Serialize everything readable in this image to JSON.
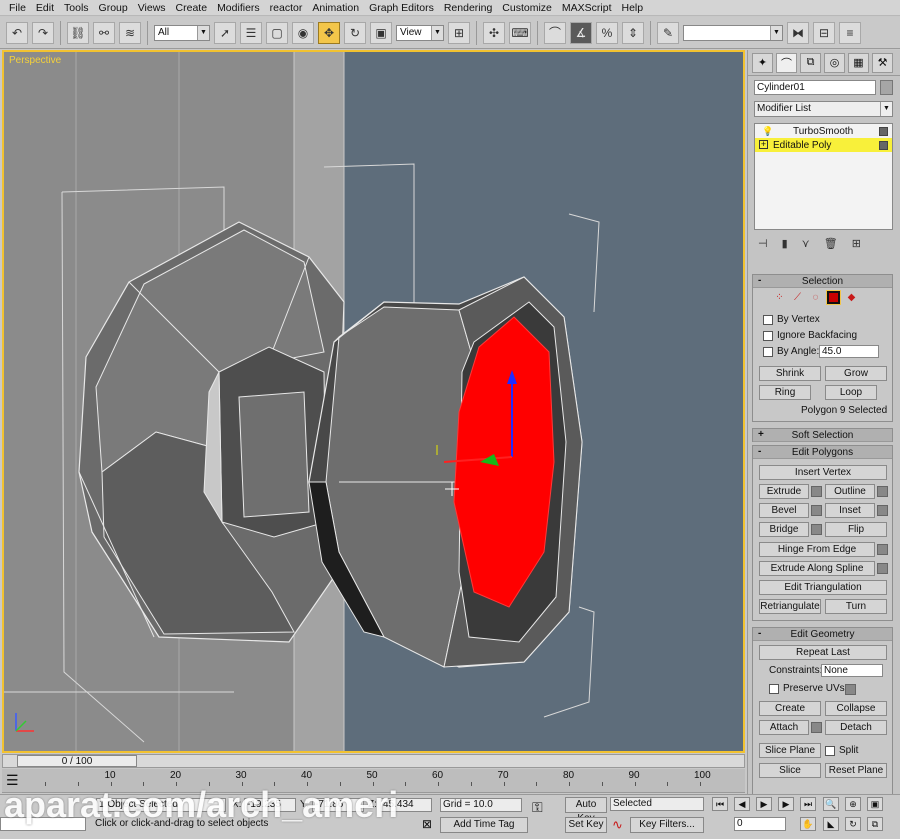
{
  "menu": [
    "File",
    "Edit",
    "Tools",
    "Group",
    "Views",
    "Create",
    "Modifiers",
    "reactor",
    "Animation",
    "Graph Editors",
    "Rendering",
    "Customize",
    "MAXScript",
    "Help"
  ],
  "toolbar": {
    "filter": "All",
    "ref_coord": "View",
    "named_sel": ""
  },
  "viewport": {
    "label": "Perspective",
    "colors": {
      "background": "#5e6d7b",
      "wall": "#8c8c8c",
      "selected_face": "#ff0000",
      "border": "#f2c230"
    }
  },
  "command_panel": {
    "object_name": "Cylinder01",
    "modifier_list": "Modifier List",
    "stack": [
      {
        "label": "TurboSmooth",
        "selected": false,
        "icon": "bulb-icon"
      },
      {
        "label": "Editable Poly",
        "selected": true,
        "icon": "plus-icon"
      }
    ],
    "selection": {
      "title": "Selection",
      "by_vertex": "By Vertex",
      "ignore_backfacing": "Ignore Backfacing",
      "by_angle": "By Angle:",
      "angle_value": "45.0",
      "shrink": "Shrink",
      "grow": "Grow",
      "ring": "Ring",
      "loop": "Loop",
      "status": "Polygon 9 Selected"
    },
    "soft_selection": {
      "title": "Soft Selection"
    },
    "edit_polygons": {
      "title": "Edit Polygons",
      "insert_vertex": "Insert Vertex",
      "extrude": "Extrude",
      "outline": "Outline",
      "bevel": "Bevel",
      "inset": "Inset",
      "bridge": "Bridge",
      "flip": "Flip",
      "hinge": "Hinge From Edge",
      "extrude_spline": "Extrude Along Spline",
      "edit_tri": "Edit Triangulation",
      "retriangulate": "Retriangulate",
      "turn": "Turn"
    },
    "edit_geometry": {
      "title": "Edit Geometry",
      "repeat_last": "Repeat Last",
      "constraints": "Constraints:",
      "constraints_value": "None",
      "preserve_uvs": "Preserve UVs",
      "create": "Create",
      "collapse": "Collapse",
      "attach": "Attach",
      "detach": "Detach",
      "slice_plane": "Slice Plane",
      "split": "Split",
      "slice": "Slice",
      "reset_plane": "Reset Plane"
    }
  },
  "timeline": {
    "frame_display": "0 / 100",
    "ticks": [
      "10",
      "20",
      "30",
      "40",
      "50",
      "60",
      "70",
      "80",
      "90",
      "100"
    ]
  },
  "status": {
    "selection_text": "1 Object Selected",
    "prompt": "Click or click-and-drag to select objects",
    "x_label": "X:",
    "x_value": "-19.235",
    "y_label": "Y:",
    "y_value": "-71.86",
    "z_label": "Z:",
    "z_value": "45.434",
    "grid": "Grid = 10.0",
    "auto_key": "Auto Key",
    "set_key": "Set Key",
    "key_mode": "Selected",
    "key_filters": "Key Filters...",
    "add_time_tag": "Add Time Tag",
    "frame": "0"
  },
  "watermark": "aparat.com/arch_ameri"
}
